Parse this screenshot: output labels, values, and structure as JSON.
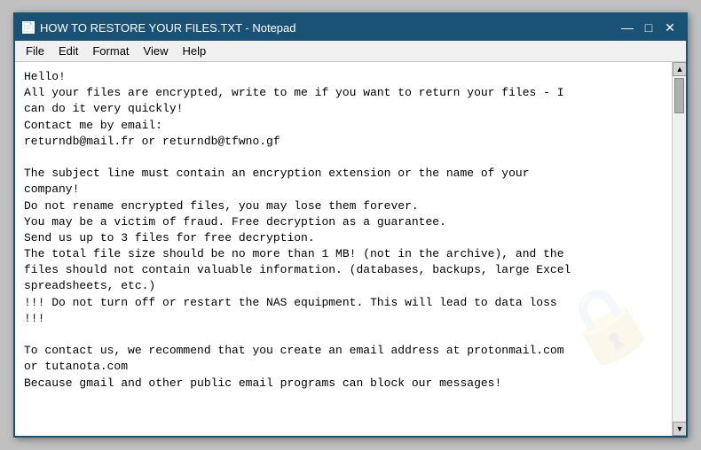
{
  "window": {
    "title": "HOW TO RESTORE YOUR FILES.TXT - Notepad",
    "title_icon": "📄"
  },
  "title_bar": {
    "minimize_label": "—",
    "maximize_label": "□",
    "close_label": "✕"
  },
  "menu": {
    "items": [
      "File",
      "Edit",
      "Format",
      "View",
      "Help"
    ]
  },
  "content": {
    "text": "Hello!\nAll your files are encrypted, write to me if you want to return your files - I\ncan do it very quickly!\nContact me by email:\nreturndb@mail.fr or returndb@tfwno.gf\n\nThe subject line must contain an encryption extension or the name of your\ncompany!\nDo not rename encrypted files, you may lose them forever.\nYou may be a victim of fraud. Free decryption as a guarantee.\nSend us up to 3 files for free decryption.\nThe total file size should be no more than 1 MB! (not in the archive), and the\nfiles should not contain valuable information. (databases, backups, large Excel\nspreadsheets, etc.)\n!!! Do not turn off or restart the NAS equipment. This will lead to data loss\n!!!\n\nTo contact us, we recommend that you create an email address at protonmail.com\nor tutanota.com\nBecause gmail and other public email programs can block our messages!"
  }
}
